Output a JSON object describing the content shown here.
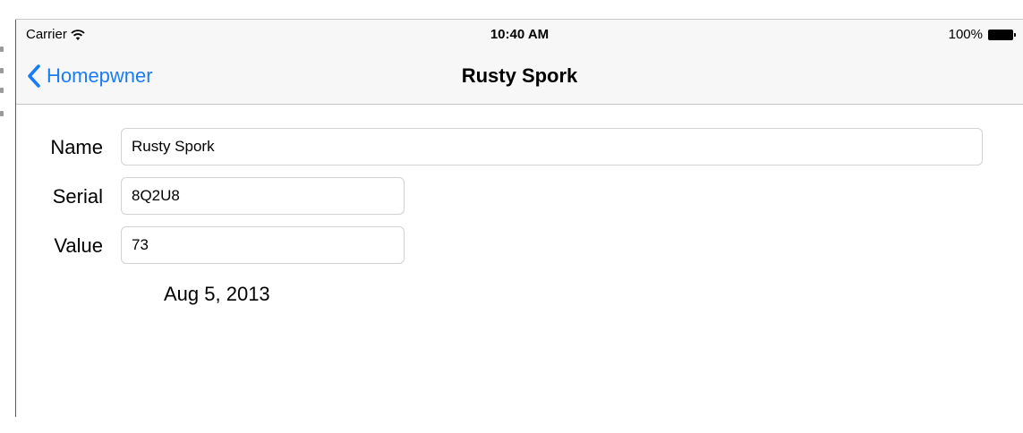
{
  "status_bar": {
    "carrier": "Carrier",
    "time": "10:40 AM",
    "battery_percent": "100%",
    "wifi_icon": "wifi-icon",
    "battery_icon": "battery-icon"
  },
  "nav": {
    "back_label": "Homepwner",
    "title": "Rusty Spork",
    "accent_color": "#1a7cf5"
  },
  "form": {
    "name": {
      "label": "Name",
      "value": "Rusty Spork"
    },
    "serial": {
      "label": "Serial",
      "value": "8Q2U8"
    },
    "value": {
      "label": "Value",
      "value": "73"
    }
  },
  "date": "Aug 5, 2013"
}
